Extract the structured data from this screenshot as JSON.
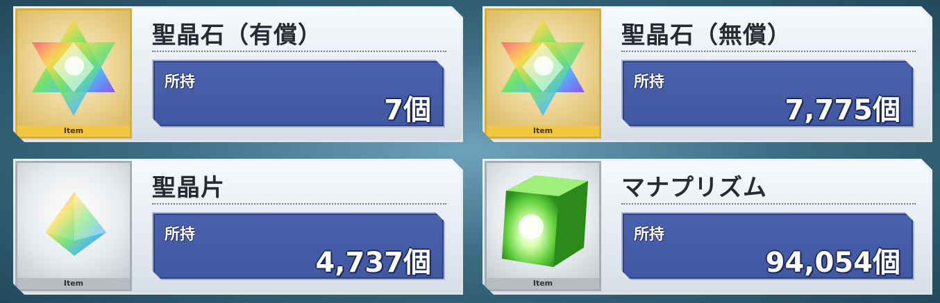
{
  "colors": {
    "panel": "#4058a2",
    "gold_frame": "#d9ad36",
    "silver_frame": "#a9adb1"
  },
  "items": [
    {
      "title": "聖晶石（有償）",
      "owned_label": "所持",
      "count": "7個",
      "badge": "Item",
      "frame": "gold",
      "icon": "saint-quartz-icon"
    },
    {
      "title": "聖晶石（無償）",
      "owned_label": "所持",
      "count": "7,775個",
      "badge": "Item",
      "frame": "gold",
      "icon": "saint-quartz-icon"
    },
    {
      "title": "聖晶片",
      "owned_label": "所持",
      "count": "4,737個",
      "badge": "Item",
      "frame": "silver",
      "icon": "quartz-fragment-icon"
    },
    {
      "title": "マナプリズム",
      "owned_label": "所持",
      "count": "94,054個",
      "badge": "Item",
      "frame": "silver",
      "icon": "mana-prism-icon"
    }
  ]
}
